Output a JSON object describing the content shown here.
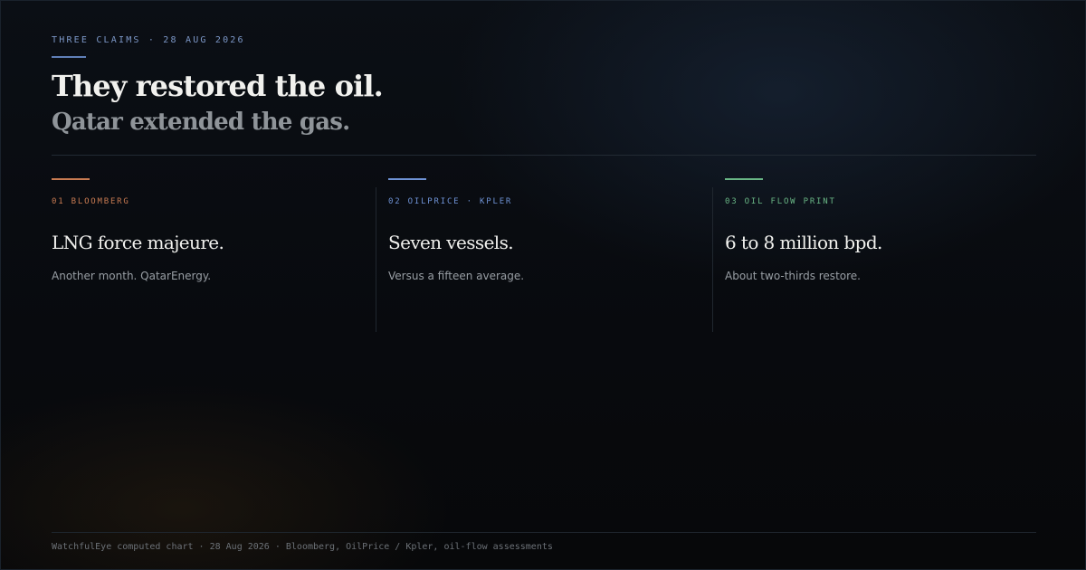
{
  "kicker": "THREE CLAIMS · 28 AUG 2026",
  "headline": "They restored the oil.",
  "subheadline": "Qatar extended the gas.",
  "claims": [
    {
      "source": "01 BLOOMBERG",
      "title": "LNG force majeure.",
      "body": "Another month. QatarEnergy.",
      "accent_color": "#c87b52"
    },
    {
      "source": "02 OILPRICE · KPLER",
      "title": "Seven vessels.",
      "body": "Versus a fifteen average.",
      "accent_color": "#6f93d6"
    },
    {
      "source": "03 OIL FLOW PRINT",
      "title": "6 to 8 million bpd.",
      "body": "About two-thirds restore.",
      "accent_color": "#69b685"
    }
  ],
  "footer": "WatchfulEye computed chart · 28 Aug 2026 · Bloomberg, OilPrice / Kpler, oil-flow assessments",
  "colors": {
    "kicker": "#7c97c7",
    "headline": "#f1f1ee",
    "subheadline": "#8f9499",
    "background": "#07090c"
  }
}
